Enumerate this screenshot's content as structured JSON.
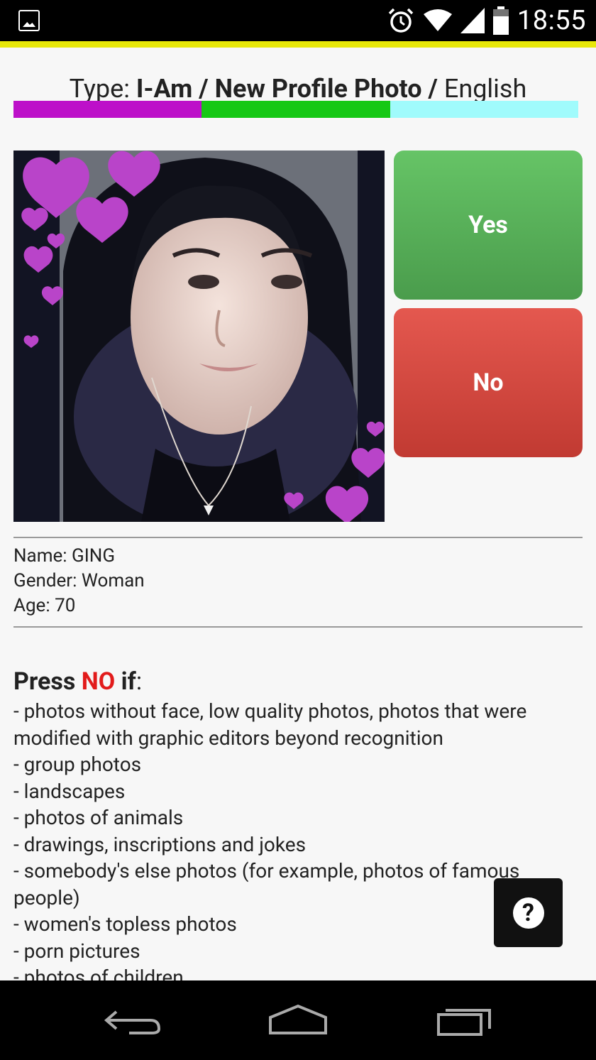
{
  "status_bar": {
    "time": "18:55",
    "icons": [
      "image-icon",
      "alarm-icon",
      "wifi-icon",
      "signal-icon",
      "battery-icon"
    ]
  },
  "accent_color": "#e8e80a",
  "header": {
    "type_label": "Type: ",
    "type_value": "I-Am / New Profile Photo",
    "separator": " / ",
    "language": "English"
  },
  "progress_colors": [
    "#bd10c9",
    "#16c815",
    "#a0fbfc"
  ],
  "actions": {
    "yes_label": "Yes",
    "no_label": "No",
    "yes_color": "#5cb85c",
    "no_color": "#d9534f"
  },
  "profile": {
    "name_line": "Name: GING",
    "gender_line": "Gender: Woman",
    "age_line": "Age: 70"
  },
  "rules": {
    "press": "Press ",
    "no": "NO",
    "if": " if",
    "colon": ":",
    "items": [
      "- photos without face, low quality photos, photos that were modified with graphic editors beyond recognition",
      "- group photos",
      "- landscapes",
      "- photos of animals",
      "- drawings, inscriptions and jokes",
      "- somebody's else photos (for example, photos of famous people)",
      "- women's topless photos",
      "- porn pictures",
      "- photos of children"
    ]
  },
  "help_label": "?"
}
